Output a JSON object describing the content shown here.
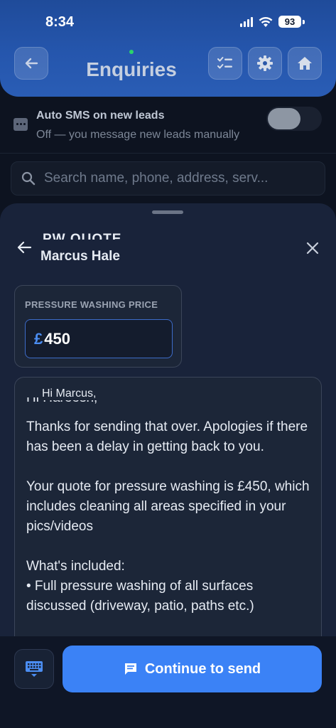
{
  "status_bar": {
    "time": "8:34",
    "battery": "93"
  },
  "header": {
    "title": "Enquiries"
  },
  "auto_sms": {
    "title": "Auto SMS on new leads",
    "subtitle": "Off — you message new leads manually",
    "enabled": false
  },
  "search": {
    "placeholder": "Search name, phone, address, serv..."
  },
  "sheet": {
    "quote_label": "PW QUOTE",
    "customer_name": "Marcus Hale",
    "price_label": "PRESSURE WASHING PRICE",
    "currency_symbol": "£",
    "price_value": "450",
    "greeting_overlay": "Hi Marcus,",
    "greeting_underlay": "Hi Hareesh,",
    "message": "Thanks for sending that over. Apologies if there has been a delay in getting back to you.\n\nYour quote for pressure washing is £450, which includes cleaning all areas specified in your pics/videos\n\nWhat's included:\n• Full pressure washing of all surfaces discussed (driveway, patio, paths etc.)"
  },
  "bottom_bar": {
    "continue_label": "Continue to send"
  },
  "colors": {
    "accent": "#3b82f6",
    "header_blue": "#2556ad",
    "sheet_bg": "#19233a"
  },
  "icons": [
    "back-arrow-icon",
    "checklist-icon",
    "gear-icon",
    "home-icon",
    "chat-icon",
    "search-icon",
    "close-icon",
    "keyboard-icon",
    "message-icon"
  ]
}
